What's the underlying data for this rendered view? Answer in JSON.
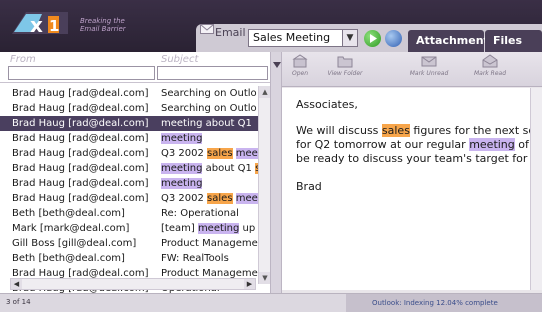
{
  "app": {
    "tagline_line1": "Breaking the",
    "tagline_line2": "Email Barrier",
    "accent": "#4a3f5f",
    "highlight_sales": "#f7a54a",
    "highlight_meeting": "#c9b4ef"
  },
  "search": {
    "scope_label": "Email",
    "query": "Sales Meeting",
    "go_icon": "go-arrow-icon",
    "web_icon": "globe-icon"
  },
  "tabs": [
    {
      "label": "Attachments"
    },
    {
      "label": "Files"
    }
  ],
  "list": {
    "from_header": "From",
    "subject_header": "Subject",
    "rows": [
      {
        "from": "Brad Haug [rad@deal.com]",
        "subject": [
          {
            "t": "Searching on Outlo"
          }
        ]
      },
      {
        "from": "Brad Haug [rad@deal.com]",
        "subject": [
          {
            "t": "Searching on Outlo"
          }
        ]
      },
      {
        "from": "Brad Haug [rad@deal.com]",
        "subject": [
          {
            "t": "meeting about Q1"
          }
        ],
        "selected": true
      },
      {
        "from": "Brad Haug [rad@deal.com]",
        "subject": [
          {
            "t": "meeting",
            "hl": "meeting"
          }
        ]
      },
      {
        "from": "Brad Haug [rad@deal.com]",
        "subject": [
          {
            "t": "Q3 2002 "
          },
          {
            "t": "sales",
            "hl": "sales"
          },
          {
            "t": " "
          },
          {
            "t": "mee",
            "hl": "meeting"
          }
        ]
      },
      {
        "from": "Brad Haug [rad@deal.com]",
        "subject": [
          {
            "t": "meeting",
            "hl": "meeting"
          },
          {
            "t": " about Q1 "
          },
          {
            "t": "s",
            "hl": "sales"
          }
        ]
      },
      {
        "from": "Brad Haug [rad@deal.com]",
        "subject": [
          {
            "t": "meeting",
            "hl": "meeting"
          }
        ]
      },
      {
        "from": "Brad Haug [rad@deal.com]",
        "subject": [
          {
            "t": "Q3 2002 "
          },
          {
            "t": "sales",
            "hl": "sales"
          },
          {
            "t": " "
          },
          {
            "t": "mee",
            "hl": "meeting"
          }
        ]
      },
      {
        "from": "Beth [beth@deal.com]",
        "subject": [
          {
            "t": "Re: Operational"
          }
        ]
      },
      {
        "from": "Mark [mark@deal.com]",
        "subject": [
          {
            "t": "[team] "
          },
          {
            "t": "meeting",
            "hl": "meeting"
          },
          {
            "t": " up"
          }
        ]
      },
      {
        "from": "Gill Boss [gill@deal.com]",
        "subject": [
          {
            "t": "Product Manageme"
          }
        ]
      },
      {
        "from": "Beth [beth@deal.com]",
        "subject": [
          {
            "t": "FW: RealTools"
          }
        ]
      },
      {
        "from": "Brad Haug [rad@deal.com]",
        "subject": [
          {
            "t": "Product Manageme"
          }
        ]
      },
      {
        "from": "Brad Haug [rad@deal.com]",
        "subject": [
          {
            "t": "Operational"
          }
        ]
      }
    ]
  },
  "toolbar": {
    "open": "Open",
    "view_folder": "View Folder",
    "mark_unread": "Mark Unread",
    "mark_read": "Mark Read"
  },
  "preview": {
    "greeting": "Associates,",
    "lines": [
      [
        {
          "t": "We will discuss "
        },
        {
          "t": "sales",
          "hl": "sales"
        },
        {
          "t": " figures for the next sch"
        }
      ],
      [
        {
          "t": "for Q2 tomorrow at our regular "
        },
        {
          "t": "meeting",
          "hl": "meeting"
        },
        {
          "t": " of th"
        }
      ],
      [
        {
          "t": "be ready to discuss your team's target for th"
        }
      ]
    ],
    "signature": "Brad"
  },
  "status": {
    "count": "3 of 14",
    "indexing": "Outlook: Indexing 12.04% complete"
  }
}
